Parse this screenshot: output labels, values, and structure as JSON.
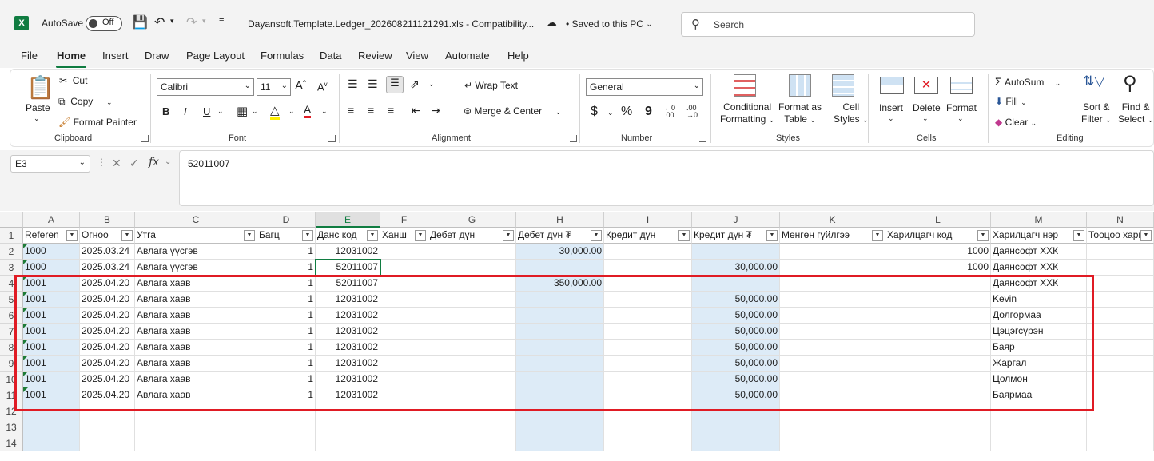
{
  "titlebar": {
    "logo": "X",
    "autosave_label": "AutoSave",
    "autosave_state": "Off",
    "filename": "Dayansoft.Template.Ledger_202608211121291.xls  -  Compatibility...",
    "saved_status": "Saved to this PC",
    "search_placeholder": "Search"
  },
  "menu": [
    "File",
    "Home",
    "Insert",
    "Draw",
    "Page Layout",
    "Formulas",
    "Data",
    "Review",
    "View",
    "Automate",
    "Help"
  ],
  "ribbon": {
    "clipboard": {
      "paste": "Paste",
      "cut": "Cut",
      "copy": "Copy",
      "format_painter": "Format Painter",
      "label": "Clipboard"
    },
    "font": {
      "name": "Calibri",
      "size": "11",
      "bold": "B",
      "italic": "I",
      "underline": "U",
      "label": "Font"
    },
    "alignment": {
      "wrap_text": "Wrap Text",
      "merge_center": "Merge & Center",
      "label": "Alignment"
    },
    "number": {
      "format": "General",
      "currency": "$",
      "percent": "%",
      "comma": "9",
      "label": "Number"
    },
    "styles": {
      "conditional": "Conditional",
      "conditional2": "Formatting",
      "format_as": "Format as",
      "format_as2": "Table",
      "cell_styles": "Cell",
      "cell_styles2": "Styles",
      "label": "Styles"
    },
    "cells": {
      "insert": "Insert",
      "delete": "Delete",
      "format": "Format",
      "label": "Cells"
    },
    "editing": {
      "autosum": "AutoSum",
      "fill": "Fill",
      "clear": "Clear",
      "sort": "Sort &",
      "sort2": "Filter",
      "find": "Find &",
      "find2": "Select",
      "label": "Editing"
    }
  },
  "formula_bar": {
    "name_box": "E3",
    "fx": "fx",
    "value": "52011007"
  },
  "columns": [
    "A",
    "B",
    "C",
    "D",
    "E",
    "F",
    "G",
    "H",
    "I",
    "J",
    "K",
    "L",
    "M",
    "N"
  ],
  "header_row": [
    "Referen",
    "Огноо",
    "Утга",
    "Багц",
    "Данс код",
    "Ханш",
    "Дебет дүн",
    "Дебет дүн ₮",
    "Кредит дүн",
    "Кредит дүн ₮",
    "Мөнгөн гүйлгээ",
    "Харилцагч код",
    "Харилцагч нэр",
    "Тооцоо харил"
  ],
  "rows": [
    [
      "1000",
      "2025.03.24",
      "Авлага үүсгэв",
      "1",
      "12031002",
      "",
      "",
      "30,000.00",
      "",
      "",
      "",
      "1000",
      "Даянсофт ХХК",
      ""
    ],
    [
      "1000",
      "2025.03.24",
      "Авлага үүсгэв",
      "1",
      "52011007",
      "",
      "",
      "",
      "",
      "30,000.00",
      "",
      "1000",
      "Даянсофт ХХК",
      ""
    ],
    [
      "1001",
      "2025.04.20",
      "Авлага хаав",
      "1",
      "52011007",
      "",
      "",
      "350,000.00",
      "",
      "",
      "",
      "",
      "Даянсофт ХХК",
      ""
    ],
    [
      "1001",
      "2025.04.20",
      "Авлага хаав",
      "1",
      "12031002",
      "",
      "",
      "",
      "",
      "50,000.00",
      "",
      "",
      "Kevin",
      ""
    ],
    [
      "1001",
      "2025.04.20",
      "Авлага хаав",
      "1",
      "12031002",
      "",
      "",
      "",
      "",
      "50,000.00",
      "",
      "",
      "Долгормаа",
      ""
    ],
    [
      "1001",
      "2025.04.20",
      "Авлага хаав",
      "1",
      "12031002",
      "",
      "",
      "",
      "",
      "50,000.00",
      "",
      "",
      "Цэцэгсүрэн",
      ""
    ],
    [
      "1001",
      "2025.04.20",
      "Авлага хаав",
      "1",
      "12031002",
      "",
      "",
      "",
      "",
      "50,000.00",
      "",
      "",
      "Баяр",
      ""
    ],
    [
      "1001",
      "2025.04.20",
      "Авлага хаав",
      "1",
      "12031002",
      "",
      "",
      "",
      "",
      "50,000.00",
      "",
      "",
      "Жаргал",
      ""
    ],
    [
      "1001",
      "2025.04.20",
      "Авлага хаав",
      "1",
      "12031002",
      "",
      "",
      "",
      "",
      "50,000.00",
      "",
      "",
      "Цолмон",
      ""
    ],
    [
      "1001",
      "2025.04.20",
      "Авлага хаав",
      "1",
      "12031002",
      "",
      "",
      "",
      "",
      "50,000.00",
      "",
      "",
      "Баярмаа",
      ""
    ]
  ],
  "row_numbers": [
    "1",
    "2",
    "3",
    "4",
    "5",
    "6",
    "7",
    "8",
    "9",
    "10",
    "11",
    "12",
    "13",
    "14"
  ],
  "colors": {
    "accent": "#107c41",
    "shade": "#ddebf7",
    "highlight_box": "#e01b24"
  }
}
